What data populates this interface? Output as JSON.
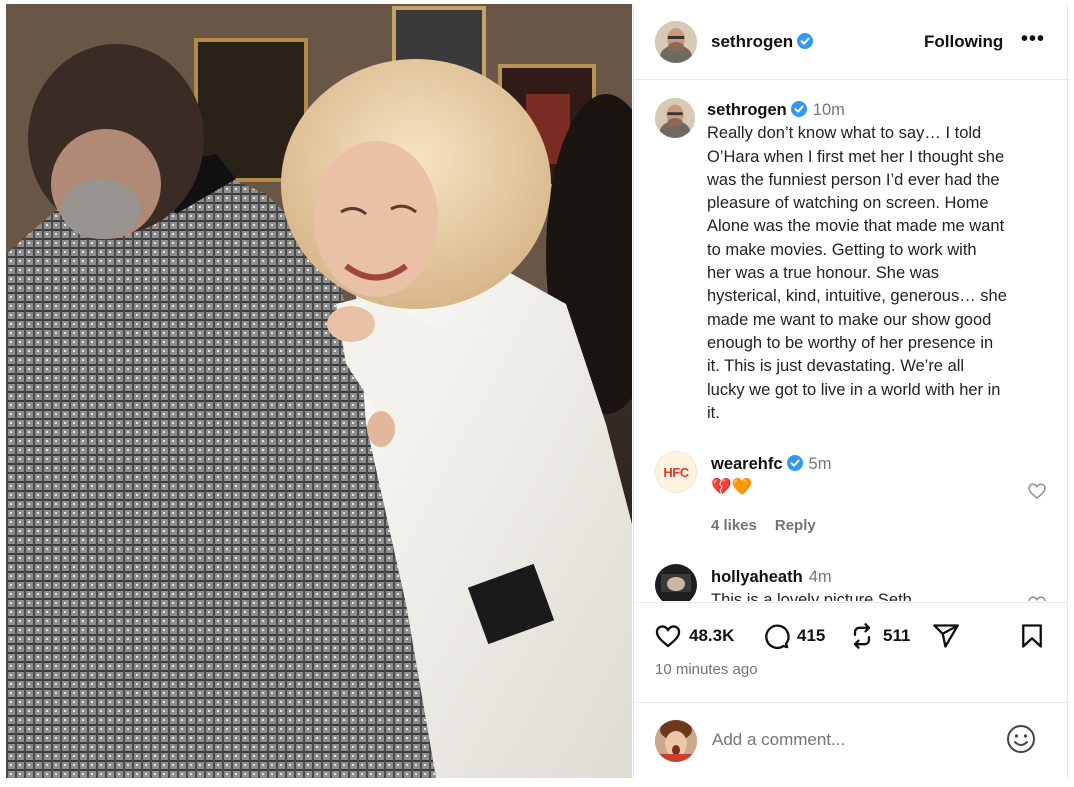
{
  "header": {
    "username": "sethrogen",
    "follow_label": "Following",
    "more_label": "•••"
  },
  "caption": {
    "username": "sethrogen",
    "time": "10m",
    "text": "Really don’t know what to say… I told\nO’Hara when I first met her I thought she\nwas the funniest person I’d ever had the\npleasure of watching on screen. Home\nAlone was the movie that made me want\nto make movies. Getting to work with\nher was a true honour. She was\nhysterical, kind, intuitive, generous… she\nmade me want to make our show good\nenough to be worthy of her presence in\nit. This is just devastating. We’re all\nlucky we got to live in a world with her in\nit."
  },
  "comments": [
    {
      "avatar_text": "HFC",
      "username": "wearehfc",
      "time": "5m",
      "body": "💔🧡",
      "likes_label": "4 likes",
      "reply_label": "Reply"
    },
    {
      "username": "hollyaheath",
      "time": "4m",
      "body": "This is a lovely picture Seth"
    }
  ],
  "actions": {
    "likes": "48.3K",
    "comments": "415",
    "reposts": "511"
  },
  "timestamp": "10 minutes ago",
  "add_comment": {
    "placeholder": "Add a comment..."
  },
  "colors": {
    "verified_blue": "#3797f0",
    "muted_text": "#737373",
    "divider": "#e8e8e8"
  },
  "icons": [
    "verified-badge-icon",
    "heart-icon",
    "comment-icon",
    "repost-icon",
    "share-icon",
    "bookmark-icon",
    "emoji-icon",
    "more-icon"
  ]
}
